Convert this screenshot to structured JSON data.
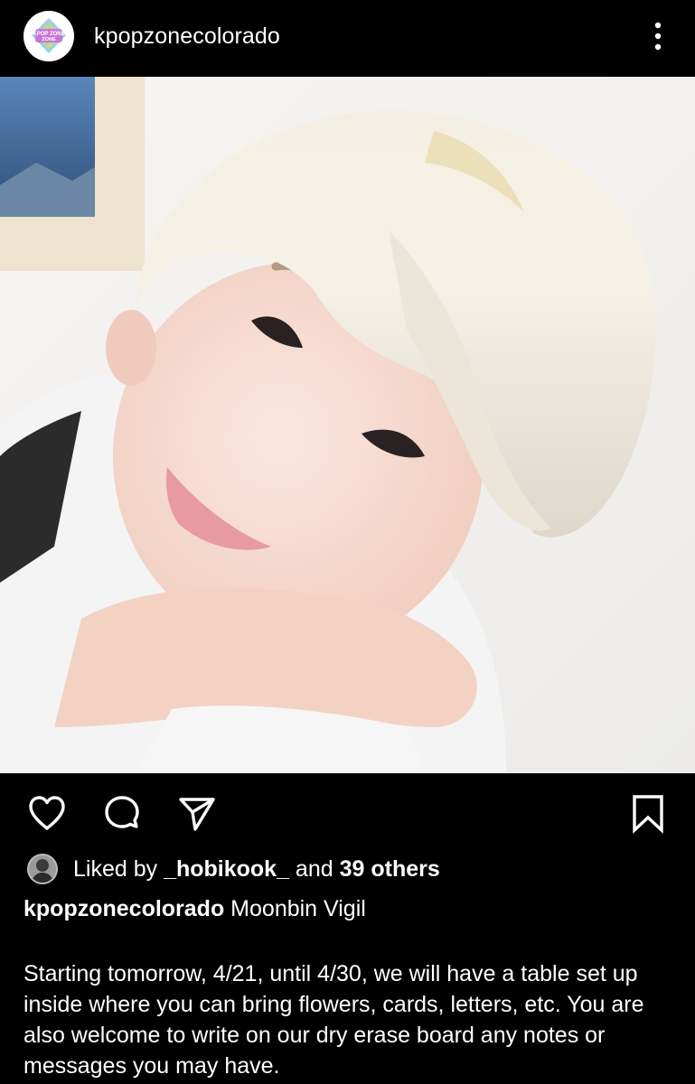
{
  "post": {
    "username": "kpopzonecolorado",
    "avatar_label": "KPOP ZONE",
    "more_icon": "more-vertical-icon",
    "photo_description_icon": "post-photo"
  },
  "actions": {
    "like_icon": "heart-icon",
    "comment_icon": "comment-icon",
    "share_icon": "send-icon",
    "save_icon": "bookmark-icon"
  },
  "likes": {
    "prefix": "Liked by ",
    "user": "_hobikook_",
    "middle": " and ",
    "others": "39 others"
  },
  "caption": {
    "username": "kpopzonecolorado",
    "title": " Moonbin Vigil",
    "body": "Starting tomorrow, 4/21, until 4/30, we will have a table set up inside where you can bring flowers, cards, letters, etc. You are also welcome to write on our dry erase board any notes or messages you may have."
  },
  "colors": {
    "background": "#000000",
    "text": "#ffffff",
    "avatar_ring": "#e7a9e6",
    "avatar_diamond": "#8fd3f0"
  }
}
